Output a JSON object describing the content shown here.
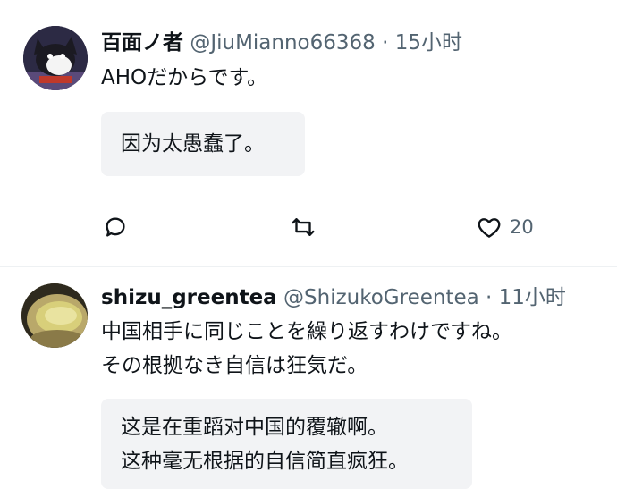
{
  "tweets": [
    {
      "display_name": "百面ノ者",
      "handle": "@JiuMianno66368",
      "separator": "·",
      "time": "15小时",
      "text": "AHOだからです。",
      "translation": [
        "因为太愚蠢了。"
      ],
      "actions": {
        "reply_icon": "speech-bubble-icon",
        "retweet_icon": "retweet-arrows-icon",
        "like_icon": "heart-icon",
        "like_count": "20"
      }
    },
    {
      "display_name": "shizu_greentea",
      "handle": "@ShizukoGreentea",
      "separator": "·",
      "time": "11小时",
      "text_lines": [
        "中国相手に同じことを繰り返すわけですね。",
        "その根拠なき自信は狂気だ。"
      ],
      "translation": [
        "这是在重蹈对中国的覆辙啊。",
        "这种毫无根据的自信简直疯狂。"
      ]
    }
  ],
  "colors": {
    "primary_text": "#0f1419",
    "secondary_text": "#536471",
    "translation_bg": "#f2f3f5"
  }
}
